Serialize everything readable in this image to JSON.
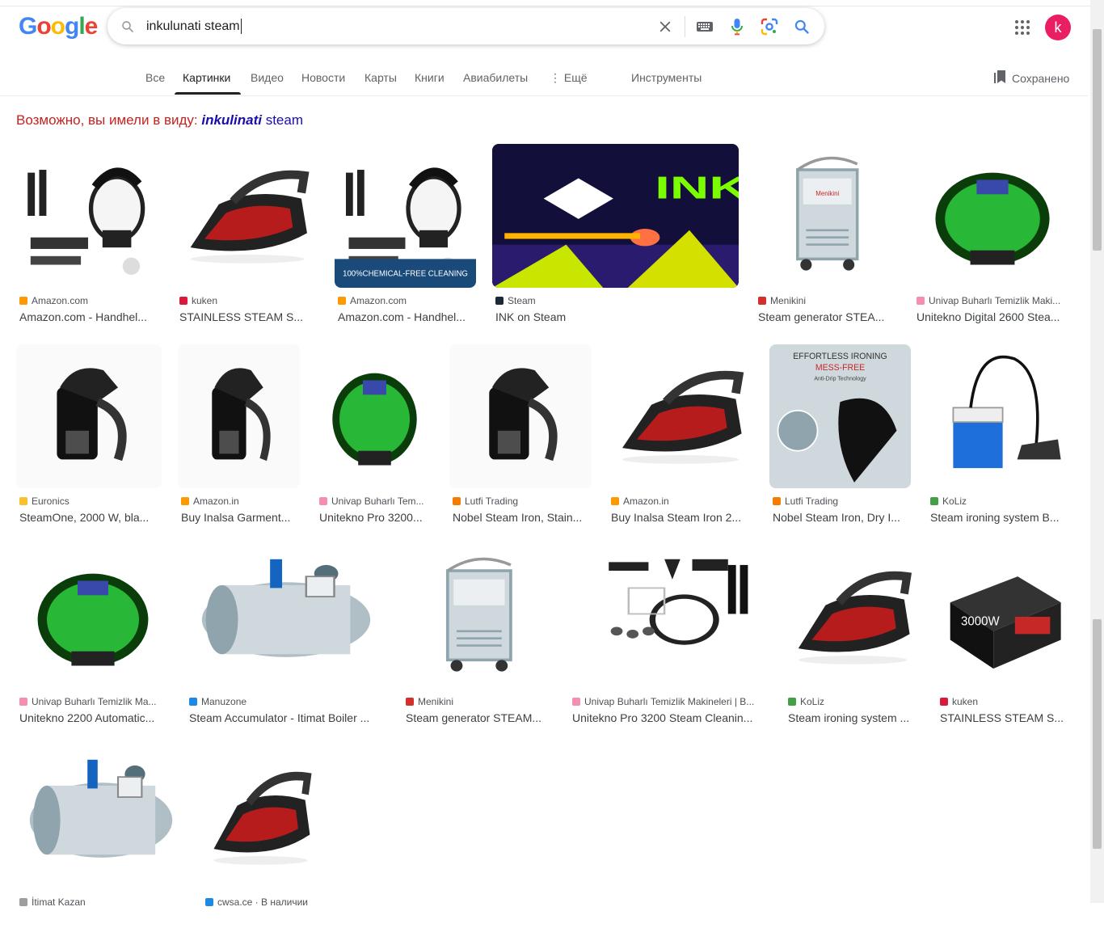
{
  "logo": {
    "g1": "G",
    "o1": "o",
    "o2": "o",
    "g2": "g",
    "l": "l",
    "e": "e"
  },
  "search": {
    "query": "inkulunati steam"
  },
  "avatar": {
    "letter": "k"
  },
  "tabs": [
    "Все",
    "Картинки",
    "Видео",
    "Новости",
    "Карты",
    "Книги",
    "Авиабилеты",
    "⋮ Ещё",
    "Инструменты"
  ],
  "saved_label": "Сохранено",
  "did_you_mean": {
    "prefix": "Возможно, вы имели в виду: ",
    "corrected": "inkulinati",
    "rest": " steam"
  },
  "colors": {
    "google_blue": "#4285F4",
    "google_red": "#EA4335",
    "google_yellow": "#FBBC05",
    "google_green": "#34A853",
    "avatar": "#e91e63",
    "link": "#1a0dab",
    "suggest": "#c5221f"
  },
  "results": [
    {
      "source": "Amazon.com",
      "title": "Amazon.com - Handhel...",
      "fav": "#f90",
      "icon": "handheld-steamer"
    },
    {
      "source": "kuken",
      "title": "STAINLESS STEAM S...",
      "fav": "#d81b3a",
      "icon": "steam-iron"
    },
    {
      "source": "Amazon.com",
      "title": "Amazon.com - Handhel...",
      "fav": "#f90",
      "icon": "handheld-steamer",
      "caption": "100%CHEMICAL-FREE CLEANING"
    },
    {
      "source": "Steam",
      "title": "INK on Steam",
      "fav": "#1b2838",
      "icon": "game-art",
      "art_text": "INK"
    },
    {
      "source": "Menikini",
      "title": "Steam generator STEA...",
      "fav": "#d32f2f",
      "icon": "steam-generator",
      "label": "Menikini"
    },
    {
      "source": "Univap Buharlı Temizlik Maki...",
      "title": "Unitekno Digital 2600 Stea...",
      "fav": "#f48fb1",
      "icon": "steam-cleaner"
    },
    {
      "source": "Euronics",
      "title": "SteamOne, 2000 W, bla...",
      "fav": "#fbc02d",
      "icon": "garment-steamer"
    },
    {
      "source": "Amazon.in",
      "title": "Buy Inalsa Garment...",
      "fav": "#f90",
      "icon": "garment-steamer"
    },
    {
      "source": "Univap Buharlı Tem...",
      "title": "Unitekno Pro 3200...",
      "fav": "#f48fb1",
      "icon": "steam-cleaner"
    },
    {
      "source": "Lutfi Trading",
      "title": "Nobel Steam Iron, Stain...",
      "fav": "#f57c00",
      "icon": "garment-steamer"
    },
    {
      "source": "Amazon.in",
      "title": "Buy Inalsa Steam Iron 2...",
      "fav": "#f90",
      "icon": "steam-iron"
    },
    {
      "source": "Lutfi Trading",
      "title": "Nobel Steam Iron, Dry I...",
      "fav": "#f57c00",
      "icon": "steam-iron",
      "ad_line1": "EFFORTLESS IRONING",
      "ad_line2": "MESS-FREE",
      "ad_line3": "Anti-Drip Technology"
    },
    {
      "source": "KoLiz",
      "title": "Steam ironing system B...",
      "fav": "#43a047",
      "icon": "ironing-system"
    },
    {
      "source": "Univap Buharlı Temizlik Ma...",
      "title": "Unitekno 2200 Automatic...",
      "fav": "#f48fb1",
      "icon": "steam-cleaner"
    },
    {
      "source": "Manuzone",
      "title": "Steam Accumulator - Itimat Boiler ...",
      "fav": "#1e88e5",
      "icon": "boiler"
    },
    {
      "source": "Menikini",
      "title": "Steam generator STEAM...",
      "fav": "#d32f2f",
      "icon": "steam-generator"
    },
    {
      "source": "Univap Buharlı Temizlik Makineleri | B...",
      "title": "Unitekno Pro 3200 Steam Cleanin...",
      "fav": "#f48fb1",
      "icon": "accessories"
    },
    {
      "source": "KoLiz",
      "title": "Steam ironing system ...",
      "fav": "#43a047",
      "icon": "steam-iron"
    },
    {
      "source": "kuken",
      "title": "STAINLESS STEAM S...",
      "fav": "#d81b3a",
      "icon": "iron-box",
      "box_text": "3000W"
    },
    {
      "source": "İtimat Kazan",
      "title": "",
      "fav": "#9e9e9e",
      "icon": "boiler"
    },
    {
      "source": "cwsa.ce · В наличии",
      "title": "",
      "fav": "#1e88e5",
      "icon": "steam-iron"
    }
  ]
}
